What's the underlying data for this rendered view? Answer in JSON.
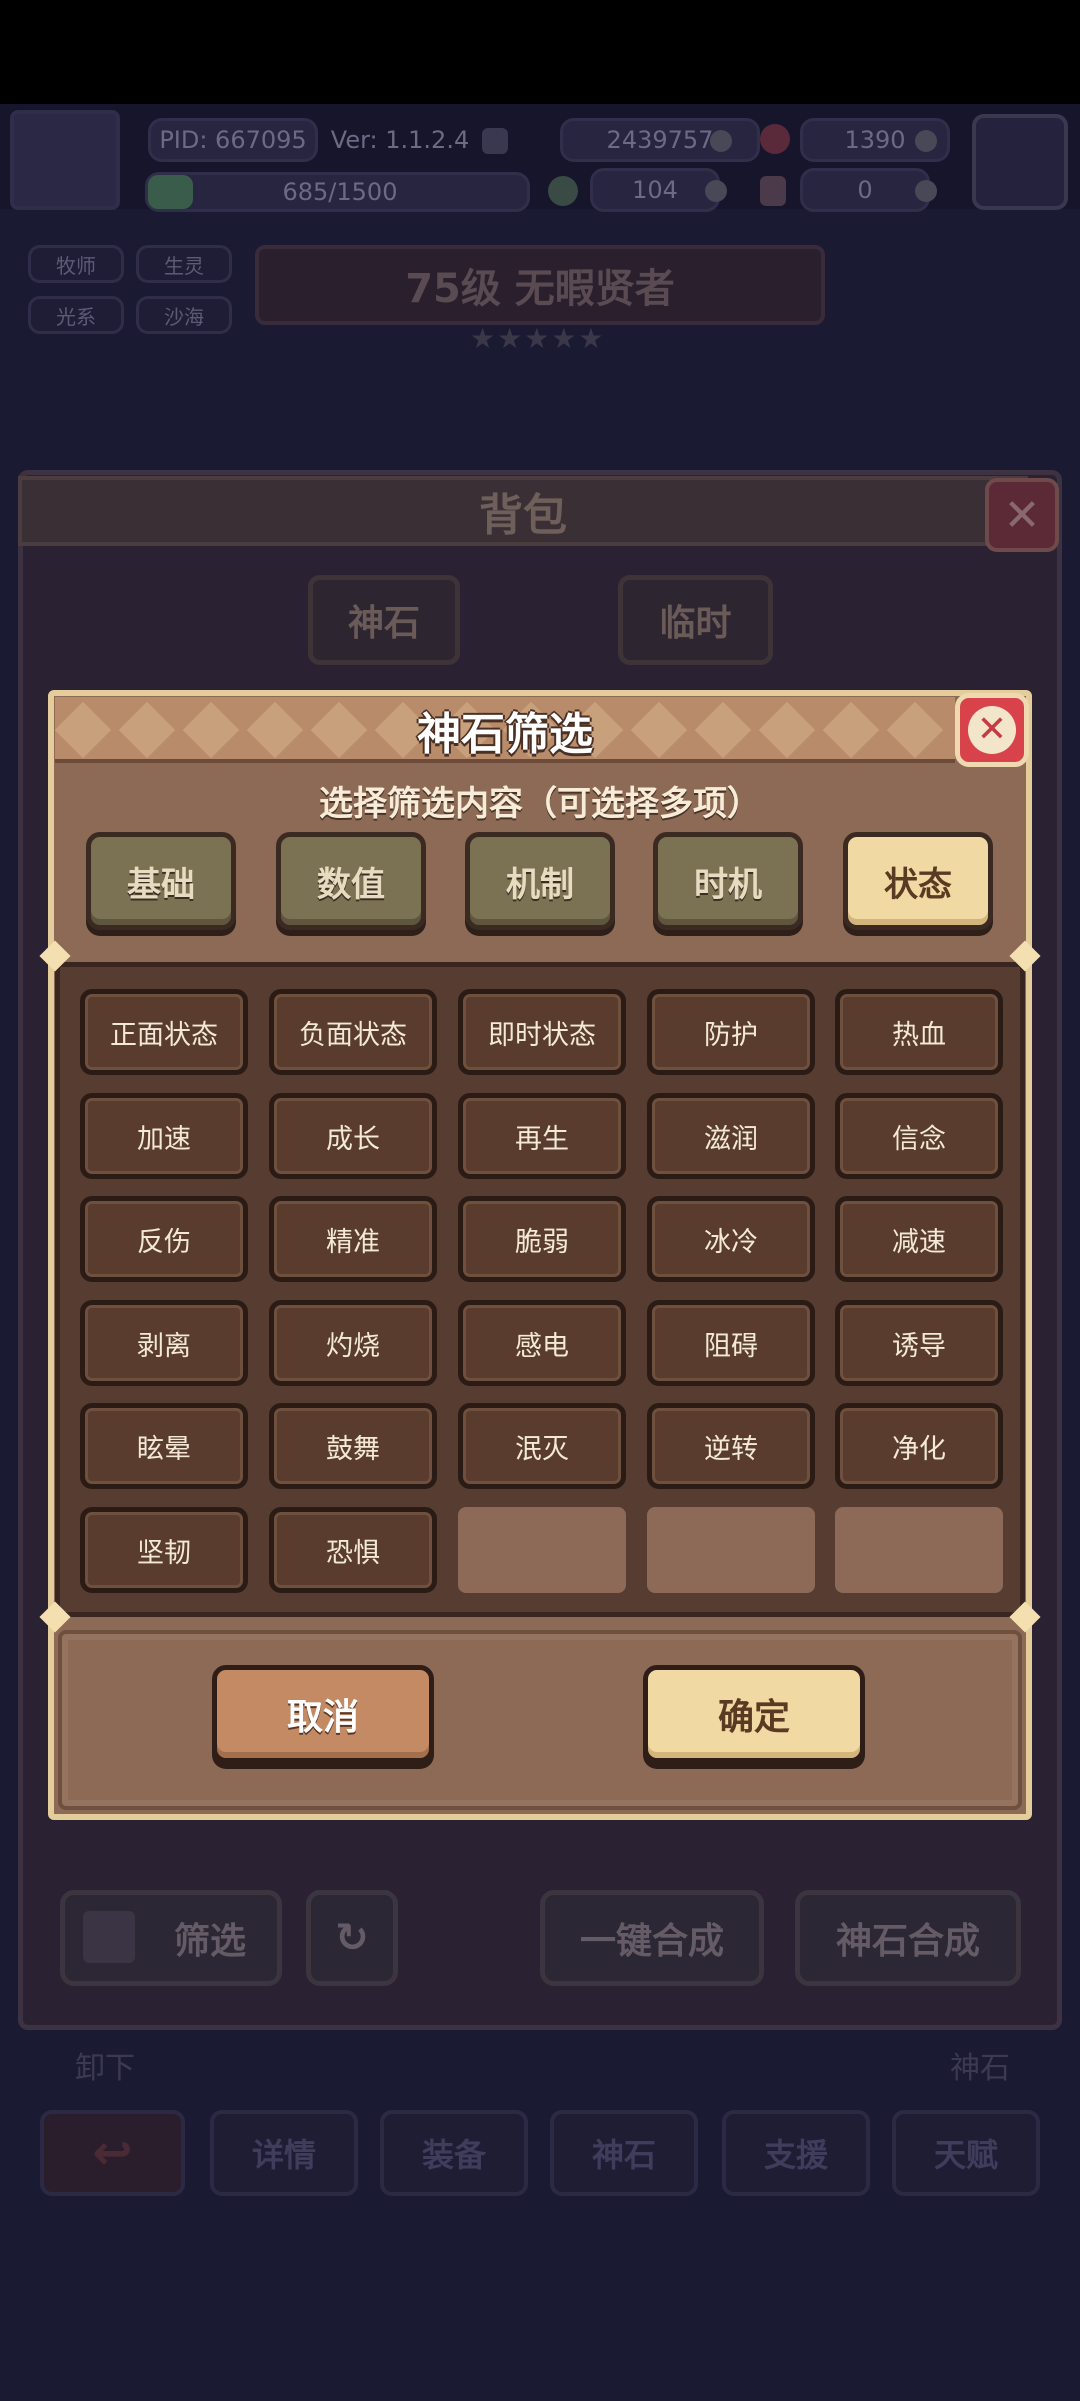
{
  "hud": {
    "pid": "PID: 667095",
    "version": "Ver: 1.1.2.4",
    "xp": "685/1500",
    "gold": "2439757",
    "gems": "1390",
    "clover": "104",
    "potion": "0",
    "tags": [
      "牧师",
      "生灵",
      "光系",
      "沙海"
    ],
    "rank": "75级 无暇贤者"
  },
  "bag": {
    "title": "背包",
    "tabs": [
      "神石",
      "临时"
    ],
    "filter_label": "筛选",
    "one_click": "一键合成",
    "stone_merge": "神石合成",
    "unequip": "卸下",
    "stone_label": "神石"
  },
  "nav": {
    "items": [
      "详情",
      "装备",
      "神石",
      "支援",
      "天赋"
    ]
  },
  "modal": {
    "title": "神石筛选",
    "subtitle": "选择筛选内容（可选择多项）",
    "categories": [
      "基础",
      "数值",
      "机制",
      "时机",
      "状态"
    ],
    "active_category": "状态",
    "tags": [
      "正面状态",
      "负面状态",
      "即时状态",
      "防护",
      "热血",
      "加速",
      "成长",
      "再生",
      "滋润",
      "信念",
      "反伤",
      "精准",
      "脆弱",
      "冰冷",
      "减速",
      "剥离",
      "灼烧",
      "感电",
      "阻碍",
      "诱导",
      "眩晕",
      "鼓舞",
      "泯灭",
      "逆转",
      "净化",
      "坚韧",
      "恐惧"
    ],
    "cancel": "取消",
    "confirm": "确定"
  },
  "colors": {
    "modal_bg": "#8d6a55",
    "active_tab": "#f0d9a3",
    "close_red": "#d8434b"
  }
}
